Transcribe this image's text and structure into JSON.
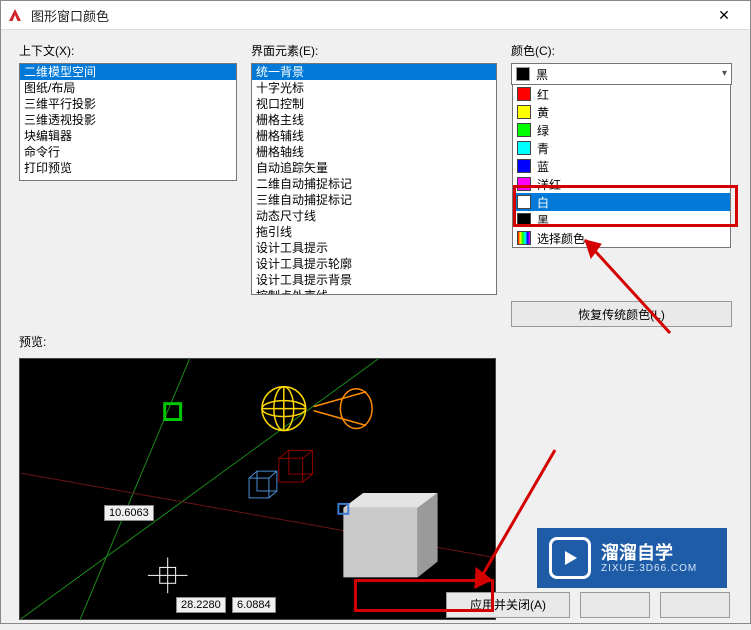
{
  "window": {
    "title": "图形窗口颜色"
  },
  "context": {
    "label": "上下文(X):",
    "items": [
      "二维模型空间",
      "图纸/布局",
      "三维平行投影",
      "三维透视投影",
      "块编辑器",
      "命令行",
      "打印预览"
    ],
    "selected": 0
  },
  "elements": {
    "label": "界面元素(E):",
    "items": [
      "统一背景",
      "十字光标",
      "视口控制",
      "栅格主线",
      "栅格辅线",
      "栅格轴线",
      "自动追踪矢量",
      "二维自动捕捉标记",
      "三维自动捕捉标记",
      "动态尺寸线",
      "拖引线",
      "设计工具提示",
      "设计工具提示轮廓",
      "设计工具提示背景",
      "控制点外壳线"
    ],
    "selected": 0
  },
  "color": {
    "label": "颜色(C):",
    "current": {
      "name": "黑",
      "swatch": "#000000"
    },
    "options": [
      {
        "name": "红",
        "swatch": "#ff0000"
      },
      {
        "name": "黄",
        "swatch": "#ffff00"
      },
      {
        "name": "绿",
        "swatch": "#00ff00"
      },
      {
        "name": "青",
        "swatch": "#00ffff"
      },
      {
        "name": "蓝",
        "swatch": "#0000ff"
      },
      {
        "name": "洋红",
        "swatch": "#ff00ff"
      },
      {
        "name": "白",
        "swatch": "#ffffff"
      },
      {
        "name": "黑",
        "swatch": "#000000"
      },
      {
        "name": "选择颜色...",
        "swatch": "rainbow"
      }
    ],
    "selected_index": 6
  },
  "restore_label": "恢复传统颜色(L)",
  "preview_label": "预览:",
  "preview_coords": {
    "a": "10.6063",
    "b": "28.2280",
    "c": "6.0884"
  },
  "buttons": {
    "apply_close": "应用并关闭(A)"
  },
  "logo": {
    "big": "溜溜自学",
    "small": "ZIXUE.3D66.COM"
  }
}
